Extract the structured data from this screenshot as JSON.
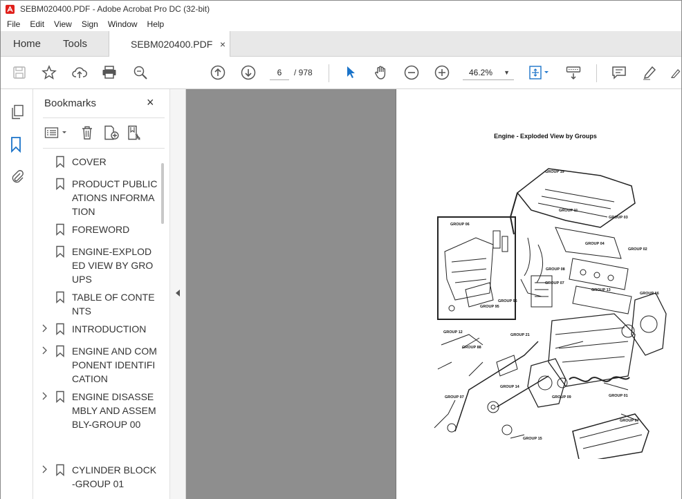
{
  "window": {
    "title": "SEBM020400.PDF - Adobe Acrobat Pro DC (32-bit)"
  },
  "menu": [
    "File",
    "Edit",
    "View",
    "Sign",
    "Window",
    "Help"
  ],
  "tabs": {
    "home": "Home",
    "tools": "Tools",
    "document": "SEBM020400.PDF",
    "close_glyph": "×"
  },
  "toolbar": {
    "current_page": "6",
    "page_total": "/ 978",
    "zoom": "46.2%"
  },
  "bookmarks": {
    "title": "Bookmarks",
    "close_glyph": "×",
    "items": [
      {
        "label": "COVER",
        "expandable": false
      },
      {
        "label": "PRODUCT PUBLICATIONS INFORMATION",
        "expandable": false
      },
      {
        "label": "FOREWORD",
        "expandable": false
      },
      {
        "label": "ENGINE-EXPLODED VIEW BY GROUPS",
        "expandable": false
      },
      {
        "label": "TABLE OF CONTENTS",
        "expandable": false
      },
      {
        "label": "INTRODUCTION",
        "expandable": true
      },
      {
        "label": "ENGINE AND COMPONENT IDENTIFICATION",
        "expandable": true
      },
      {
        "label": "ENGINE DISASSEMBLY AND ASSEMBLY-GROUP 00",
        "expandable": true
      },
      {
        "label": "CYLINDER BLOCK-GROUP 01",
        "expandable": true
      }
    ]
  },
  "document": {
    "page_title": "Engine - Exploded View by Groups",
    "group_labels": [
      "GROUP 19",
      "GROUP 11",
      "GROUP 03",
      "GROUP 06",
      "GROUP 04",
      "GROUP 02",
      "GROUP 08",
      "GROUP 07",
      "GROUP 96",
      "GROUP 95",
      "GROUP 13",
      "GROUP 16",
      "GROUP 12",
      "GROUP 21",
      "GROUP 88",
      "GROUP 14",
      "GROUP 07",
      "GROUP 09",
      "GROUP 01",
      "GROUP 15",
      "GROUP 07"
    ]
  }
}
